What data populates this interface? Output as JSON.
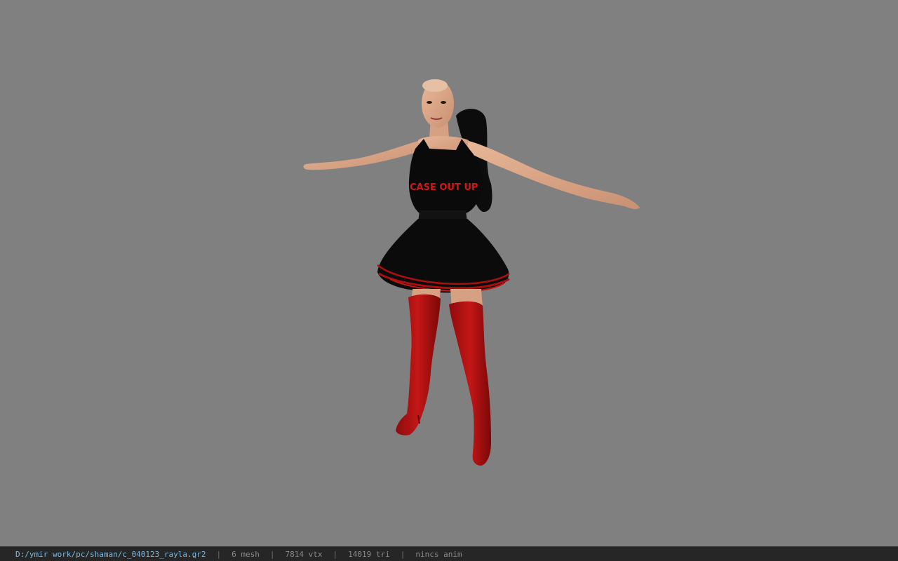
{
  "viewport": {
    "background": "#808080",
    "model_shirt_text": "CASE OUT UP"
  },
  "status": {
    "path": "D:/ymir work/pc/shaman/c_040123_rayla.gr2",
    "separator": "|",
    "mesh": "6 mesh",
    "vtx": "7814 vtx",
    "tri": "14019 tri",
    "anim": "nincs anim",
    "path_color": "#7fb8e0"
  }
}
